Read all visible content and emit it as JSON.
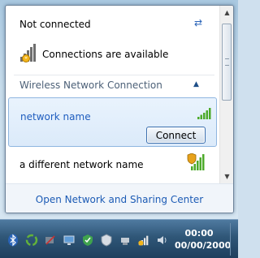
{
  "popup": {
    "status_title": "Not connected",
    "status_text": "Connections are available",
    "group_label": "Wireless Network Connection",
    "networks": [
      {
        "name": "network name",
        "signal_bars": 5,
        "secured": false,
        "selected": true,
        "connect_label": "Connect"
      },
      {
        "name": "a different network name",
        "signal_bars": 5,
        "secured": true,
        "selected": false
      }
    ],
    "footer_link": "Open Network and Sharing Center"
  },
  "taskbar": {
    "time": "00:00",
    "date": "00/00/2000",
    "tray_icons": [
      "bluetooth-icon",
      "recycle-icon",
      "speaker-muted-icon",
      "display-icon",
      "security-icon",
      "shield-icon",
      "usb-icon",
      "network-warning-icon",
      "volume-icon"
    ]
  },
  "colors": {
    "link": "#1c5bb5",
    "selected_bg": "#dbeafa",
    "signal_green": "#4caa2a",
    "taskbar": "#2f5677"
  }
}
